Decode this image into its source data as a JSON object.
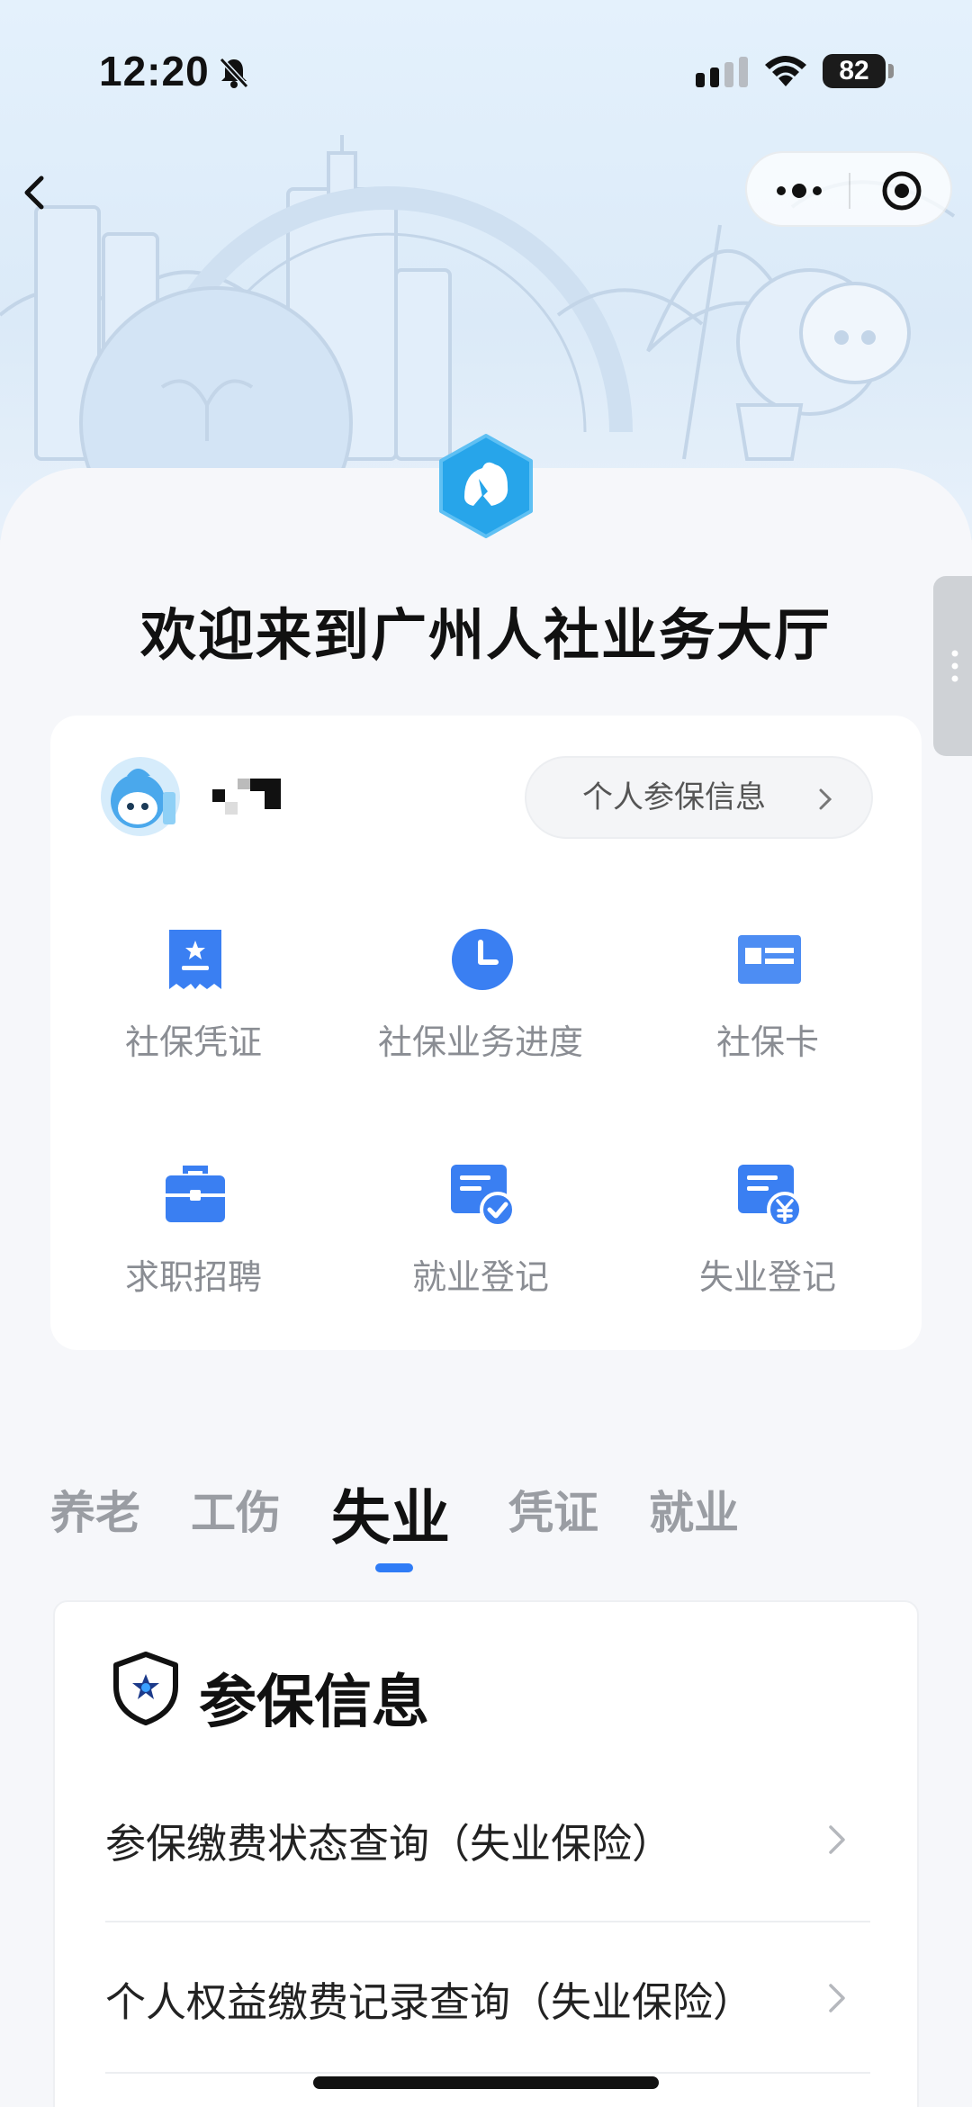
{
  "status_bar": {
    "time": "12:20",
    "battery": "82",
    "icons": [
      "bell-muted-icon",
      "signal-icon",
      "wifi-icon",
      "battery-icon"
    ]
  },
  "nav": {
    "back_icon": "chevron-left-icon",
    "capsule_icons": [
      "more-icon",
      "target-icon"
    ]
  },
  "page": {
    "title": "欢迎来到广州人社业务大厅",
    "logo_icon": "hexagon-logo-icon"
  },
  "user_card": {
    "avatar_icon": "avatar-icon",
    "info_button_label": "个人参保信息",
    "services": [
      {
        "label": "社保凭证",
        "icon": "certificate-icon",
        "color": "#3a7ff2"
      },
      {
        "label": "社保业务进度",
        "icon": "clock-icon",
        "color": "#3a7ff2"
      },
      {
        "label": "社保卡",
        "icon": "card-icon",
        "color": "#3a7ff2"
      },
      {
        "label": "求职招聘",
        "icon": "briefcase-icon",
        "color": "#3a7ff2"
      },
      {
        "label": "就业登记",
        "icon": "register-check-icon",
        "color": "#3a7ff2"
      },
      {
        "label": "失业登记",
        "icon": "register-yen-icon",
        "color": "#3a7ff2"
      }
    ]
  },
  "tabs": [
    {
      "label": "养老",
      "active": false
    },
    {
      "label": "工伤",
      "active": false
    },
    {
      "label": "失业",
      "active": true
    },
    {
      "label": "凭证",
      "active": false
    },
    {
      "label": "就业",
      "active": false
    }
  ],
  "info_section": {
    "title": "参保信息",
    "icon": "shield-star-icon",
    "items": [
      {
        "label": "参保缴费状态查询（失业保险）"
      },
      {
        "label": "个人权益缴费记录查询（失业保险）"
      }
    ]
  },
  "colors": {
    "accent": "#2f7cf6",
    "icon_blue": "#3a7ff2",
    "hero_bg": "#dbeaf8"
  }
}
